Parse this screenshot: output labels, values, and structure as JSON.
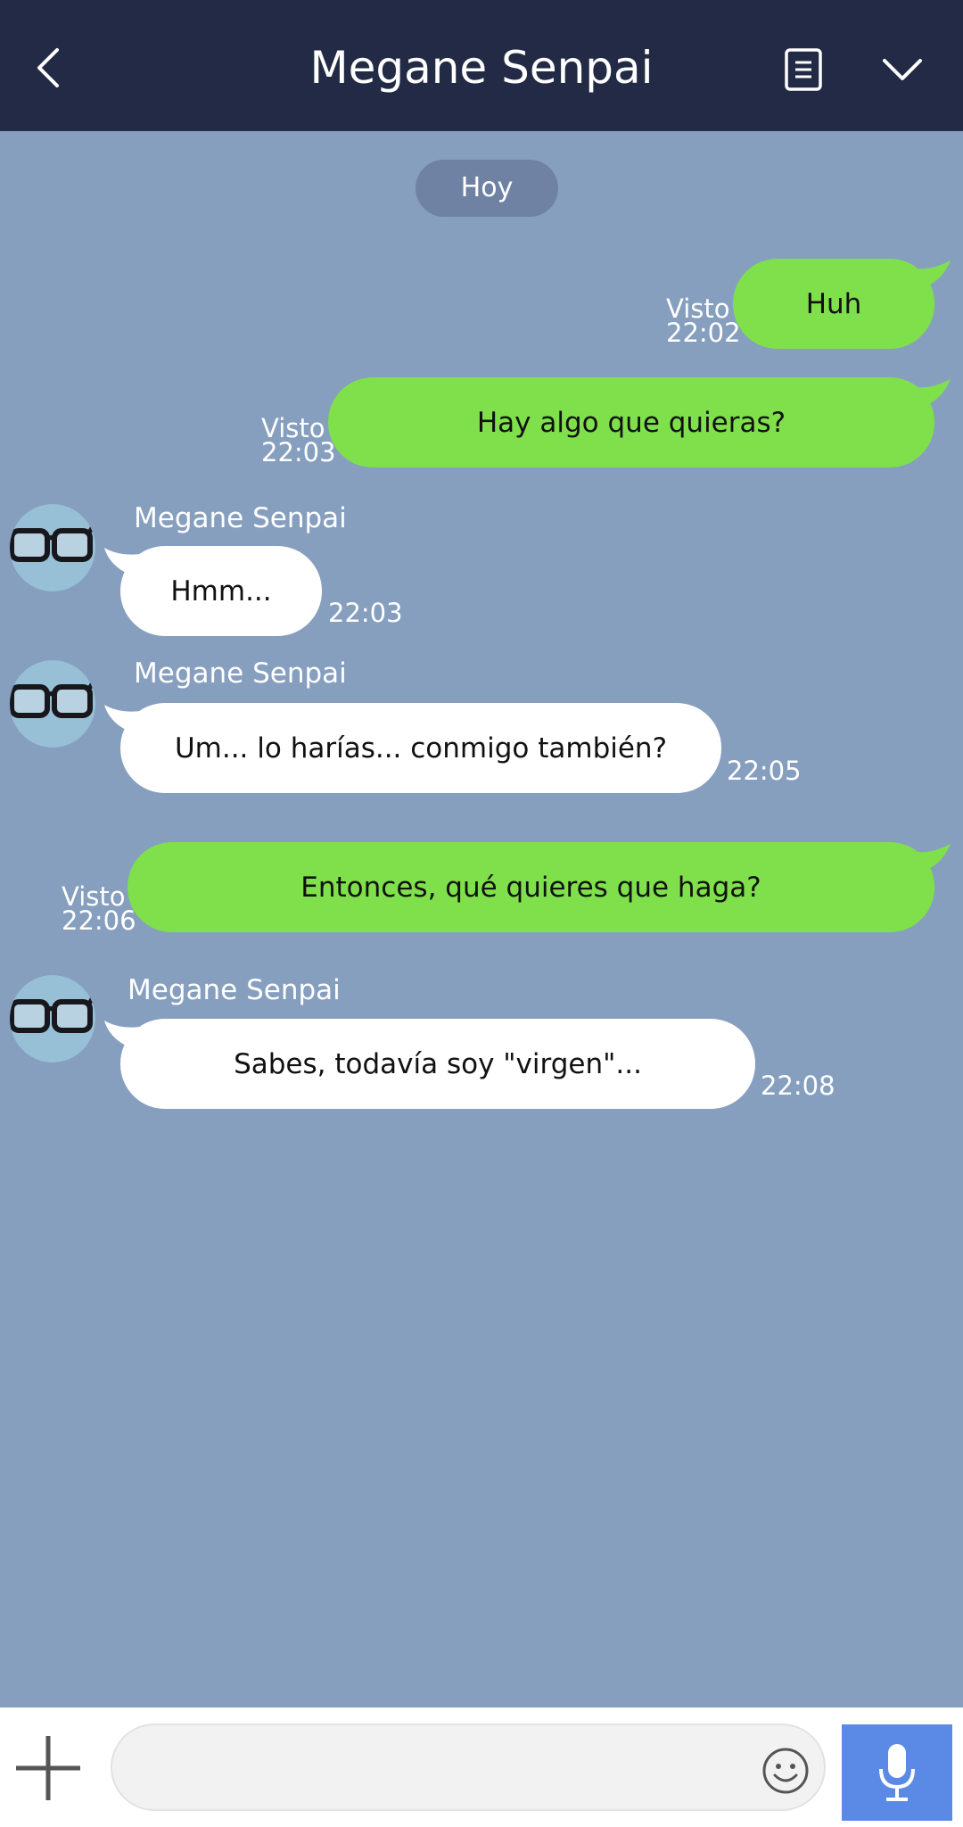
{
  "header": {
    "title": "Megane Senpai",
    "back_icon": "chevron-left-icon",
    "notes_icon": "notes-icon",
    "menu_icon": "chevron-down-icon",
    "background": "#222a45"
  },
  "chat": {
    "background": "#869fbf",
    "date_label": "Hoy",
    "messages": [
      {
        "direction": "outgoing",
        "text": "Huh",
        "read_label": "Visto",
        "time": "22:02"
      },
      {
        "direction": "outgoing",
        "text": "Hay algo que quieras?",
        "read_label": "Visto",
        "time": "22:03"
      },
      {
        "direction": "incoming",
        "sender": "Megane Senpai",
        "text": "Hmm...",
        "time": "22:03"
      },
      {
        "direction": "incoming",
        "sender": "Megane Senpai",
        "text": "Um... lo harías... conmigo también?",
        "time": "22:05"
      },
      {
        "direction": "outgoing",
        "text": "Entonces, qué quieres que haga?",
        "read_label": "Visto",
        "time": "22:06"
      },
      {
        "direction": "incoming",
        "sender": "Megane Senpai",
        "text": "Sabes, todavía soy \"virgen\"...",
        "time": "22:08"
      }
    ],
    "outgoing_color": "#7fe04c",
    "incoming_color": "#ffffff",
    "avatar_icon": "glasses-icon"
  },
  "composer": {
    "value": "",
    "add_icon": "plus-icon",
    "emoji_icon": "smiley-icon",
    "mic_icon": "microphone-icon",
    "mic_color": "#5b8ae6"
  }
}
